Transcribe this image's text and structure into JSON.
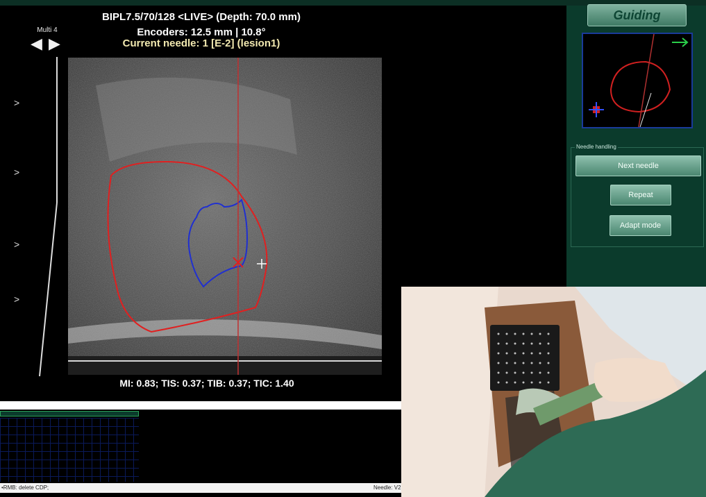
{
  "header": {
    "probe_line": "BIPL7.5/70/128 <LIVE> (Depth: 70.0 mm)",
    "encoders_line": "Encoders: 12.5 mm | 10.8°",
    "needle_line": "Current needle: 1 [E-2] (lesion1)"
  },
  "view_controls": {
    "multi_label": "Multi 4",
    "prev_symbol": "◀",
    "next_symbol": "▶",
    "chevrons": [
      ">",
      ">",
      ">",
      ">"
    ]
  },
  "metrics": "MI: 0.83; TIS: 0.37; TIB: 0.37; TIC: 1.40",
  "right_panel": {
    "guiding_label": "Guiding",
    "needle_handling": {
      "title": "Needle handling",
      "next_needle": "Next needle",
      "repeat": "Repeat",
      "adapt_mode": "Adapt mode"
    }
  },
  "status_bar": {
    "left": "•RMB: delete CDP;",
    "right": "Needle: V2"
  },
  "colors": {
    "panel_green": "#0b3b2c",
    "button_green": "#6ea893",
    "prostate_contour": "#e02020",
    "lesion_contour": "#2030d0",
    "needle_line": "#c03030",
    "title_yellow": "#f2e9b0"
  },
  "icons": {
    "prev": "triangle-left-icon",
    "next": "triangle-right-icon",
    "target": "crosshair-icon",
    "direction": "green-arrow-icon"
  }
}
